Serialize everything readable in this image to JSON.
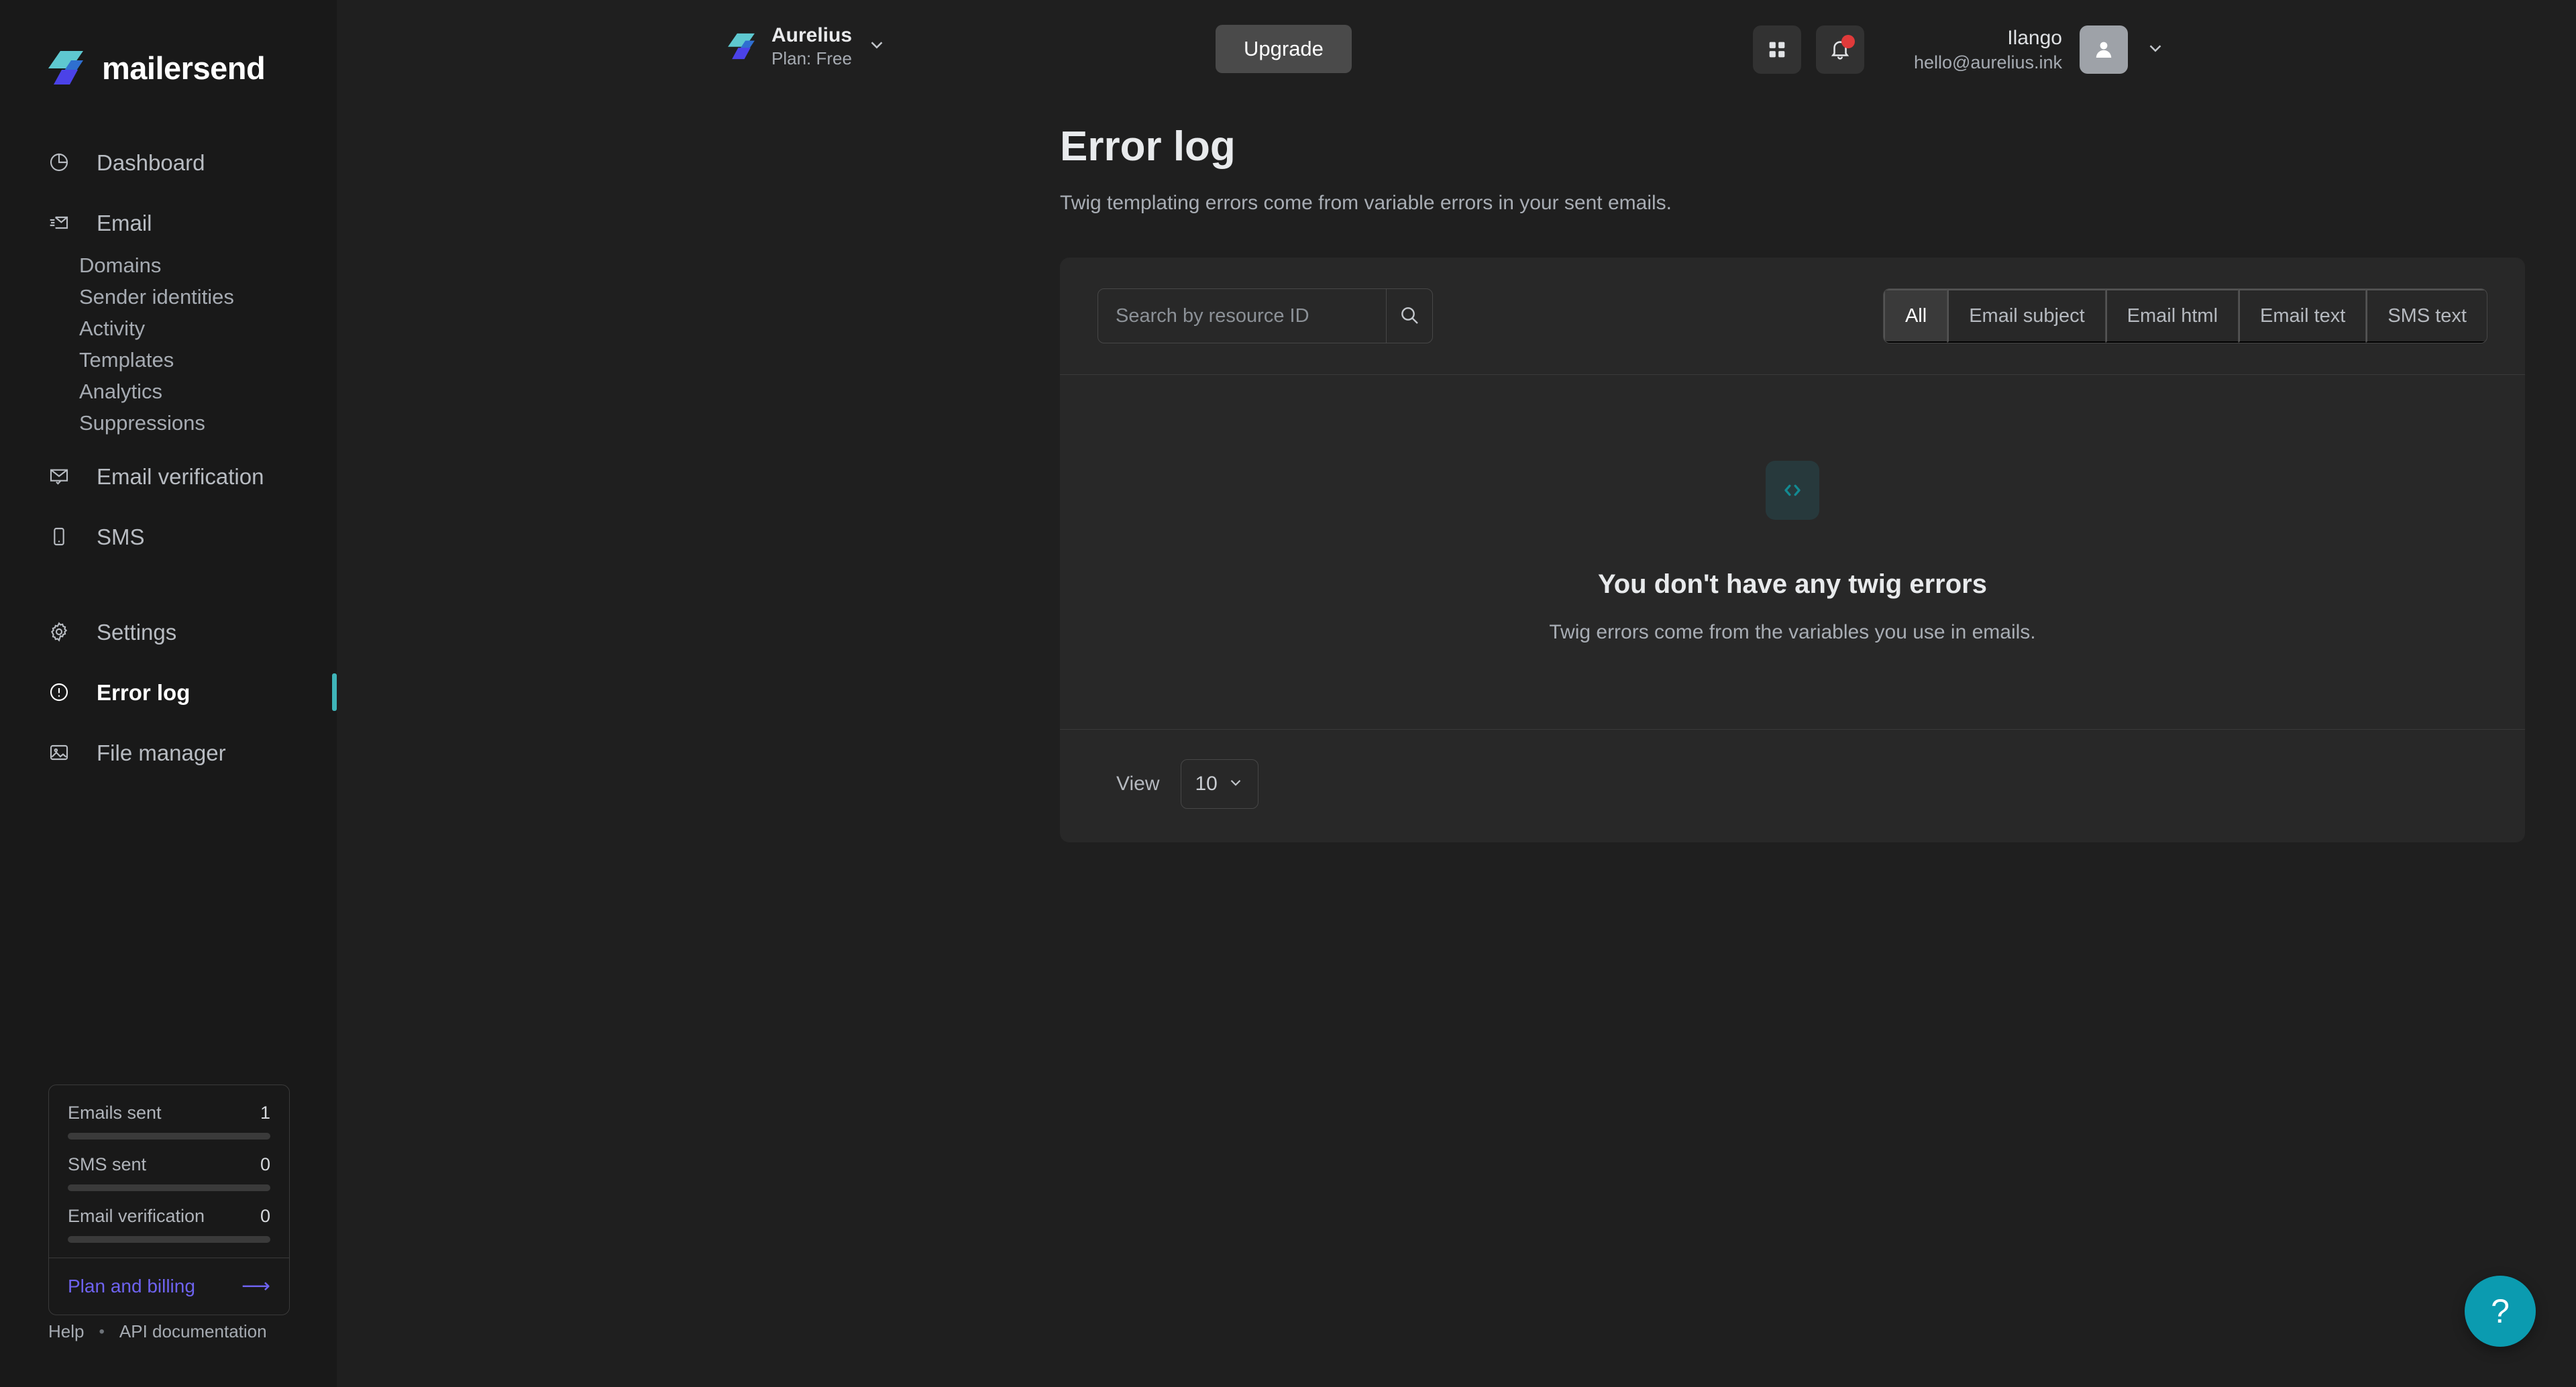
{
  "brand": {
    "name": "mailersend",
    "logo_icon": "mailersend-logo-icon",
    "teal": "#5ec8d0",
    "blue": "#2f6fd0",
    "purple": "#4b42e8"
  },
  "sidebar": {
    "items": [
      {
        "label": "Dashboard",
        "icon": "pie-chart-icon"
      },
      {
        "label": "Email",
        "icon": "envelope-send-icon"
      },
      {
        "label": "Email verification",
        "icon": "envelope-check-icon"
      },
      {
        "label": "SMS",
        "icon": "mobile-phone-icon"
      },
      {
        "label": "Settings",
        "icon": "gear-icon"
      },
      {
        "label": "Error log",
        "icon": "alert-circle-icon"
      },
      {
        "label": "File manager",
        "icon": "image-file-icon"
      }
    ],
    "email_subitems": [
      {
        "label": "Domains"
      },
      {
        "label": "Sender identities"
      },
      {
        "label": "Activity"
      },
      {
        "label": "Templates"
      },
      {
        "label": "Analytics"
      },
      {
        "label": "Suppressions"
      }
    ],
    "active_item": "Error log",
    "usage": {
      "rows": [
        {
          "label": "Emails sent",
          "value": "1",
          "progress": 0
        },
        {
          "label": "SMS sent",
          "value": "0",
          "progress": 0
        },
        {
          "label": "Email verification",
          "value": "0",
          "progress": 0
        }
      ],
      "plan_billing_label": "Plan and billing",
      "plan_billing_arrow": "⟶",
      "accent": "#6e63f0"
    },
    "footer": {
      "help": "Help",
      "separator": "•",
      "api_docs": "API documentation"
    }
  },
  "topbar": {
    "org": {
      "name": "Aurelius",
      "plan": "Plan: Free",
      "logo_icon": "mailersend-logo-icon",
      "chevron_icon": "chevron-down-icon"
    },
    "upgrade_label": "Upgrade",
    "apps_icon": "grid-apps-icon",
    "notifications_icon": "bell-icon",
    "notifications_badge": true,
    "user": {
      "name": "Ilango",
      "email": "hello@aurelius.ink",
      "avatar_icon": "user-avatar-icon",
      "chevron_icon": "chevron-down-icon"
    }
  },
  "page": {
    "title": "Error log",
    "subtitle": "Twig templating errors come from variable errors in your sent emails."
  },
  "card": {
    "search": {
      "placeholder": "Search by resource ID",
      "value": "",
      "icon": "search-icon"
    },
    "filters": [
      {
        "label": "All",
        "active": true
      },
      {
        "label": "Email subject",
        "active": false
      },
      {
        "label": "Email html",
        "active": false
      },
      {
        "label": "Email text",
        "active": false
      },
      {
        "label": "SMS text",
        "active": false
      }
    ],
    "empty_state": {
      "icon": "code-brackets-icon",
      "title": "You don't have any twig errors",
      "subtitle": "Twig errors come from the variables you use in emails.",
      "icon_color": "#128a92",
      "icon_bg": "#27393c"
    },
    "footer": {
      "view_label": "View",
      "page_size": "10",
      "chevron_icon": "chevron-down-icon"
    }
  },
  "help_fab": {
    "label": "?",
    "icon": "question-mark-icon",
    "color": "#0b9bb0"
  }
}
